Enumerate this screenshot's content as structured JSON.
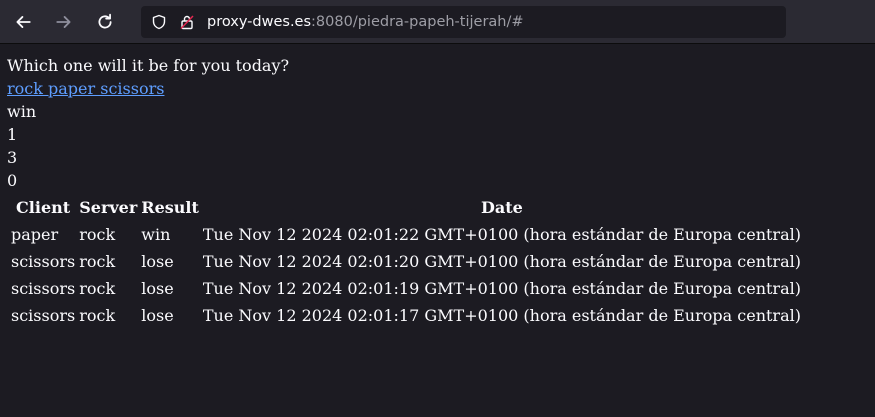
{
  "browser": {
    "url_host": "proxy-dwes.es",
    "url_rest": ":8080/piedra-papeh-tijerah/#",
    "icons": [
      "back-arrow-icon",
      "forward-arrow-icon",
      "reload-icon",
      "shield-icon",
      "lock-icon"
    ]
  },
  "page": {
    "prompt": "Which one will it be for you today?",
    "link_text": "rock paper scissors",
    "last_result": "win",
    "score_1": "1",
    "score_2": "3",
    "score_3": "0",
    "table": {
      "headers": [
        "Client",
        "Server",
        "Result",
        "Date"
      ],
      "rows": [
        [
          "paper",
          "rock",
          "win",
          "Tue Nov 12 2024 02:01:22 GMT+0100 (hora estándar de Europa central)"
        ],
        [
          "scissors",
          "rock",
          "lose",
          "Tue Nov 12 2024 02:01:20 GMT+0100 (hora estándar de Europa central)"
        ],
        [
          "scissors",
          "rock",
          "lose",
          "Tue Nov 12 2024 02:01:19 GMT+0100 (hora estándar de Europa central)"
        ],
        [
          "scissors",
          "rock",
          "lose",
          "Tue Nov 12 2024 02:01:17 GMT+0100 (hora estándar de Europa central)"
        ]
      ]
    }
  },
  "colors": {
    "background": "#1c1b22",
    "toolbar": "#2b2a33",
    "link": "#5e9eff"
  }
}
